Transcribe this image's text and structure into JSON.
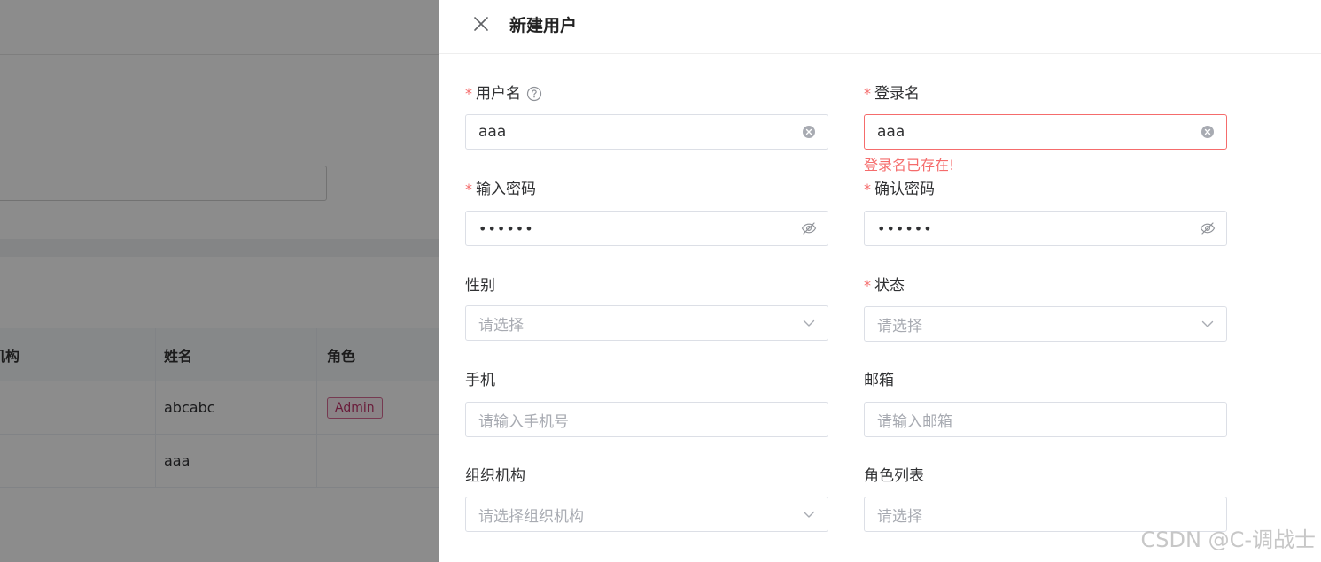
{
  "background": {
    "table": {
      "headers": [
        "机构",
        "姓名",
        "角色"
      ],
      "rows": [
        {
          "name": "abcabc",
          "role": "Admin"
        },
        {
          "name": "aaa",
          "role": ""
        }
      ]
    }
  },
  "drawer": {
    "title": "新建用户",
    "fields": {
      "username": {
        "label": "用户名",
        "value": "aaa"
      },
      "login_name": {
        "label": "登录名",
        "value": "aaa",
        "error": "登录名已存在!"
      },
      "password": {
        "label": "输入密码",
        "value": "••••••"
      },
      "confirm_password": {
        "label": "确认密码",
        "value": "••••••"
      },
      "gender": {
        "label": "性别",
        "placeholder": "请选择"
      },
      "status": {
        "label": "状态",
        "placeholder": "请选择"
      },
      "phone": {
        "label": "手机",
        "placeholder": "请输入手机号"
      },
      "email": {
        "label": "邮箱",
        "placeholder": "请输入邮箱"
      },
      "org": {
        "label": "组织机构",
        "placeholder": "请选择组织机构"
      },
      "roles": {
        "label": "角色列表",
        "placeholder": "请选择"
      }
    }
  },
  "watermark": "CSDN @C-调战士",
  "colors": {
    "required": "#f56c6c",
    "error": "#f56c6c",
    "border": "#dcdfe6",
    "placeholder": "#a8abb2",
    "overlay": "rgba(0,0,0,0.45)"
  }
}
